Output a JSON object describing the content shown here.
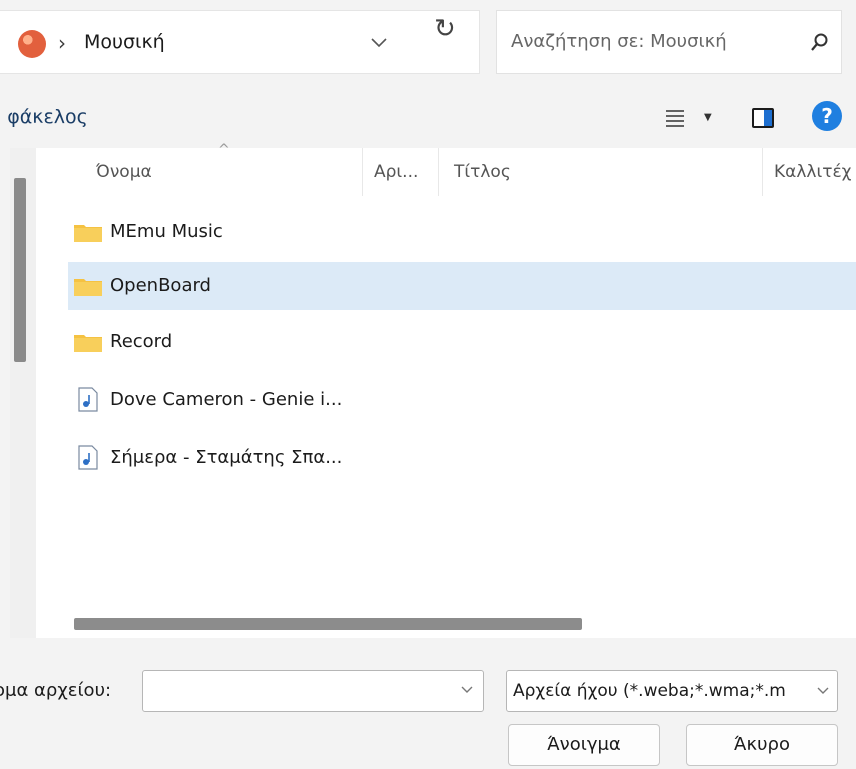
{
  "address": {
    "location": "Μουσική",
    "separator": "›"
  },
  "search": {
    "placeholder": "Αναζήτηση σε: Μουσική"
  },
  "toolbar": {
    "new_folder": "ς φάκελος",
    "help": "?",
    "refresh": "↻"
  },
  "columns": [
    "Όνομα",
    "Αρι...",
    "Τίτλος",
    "Καλλιτέχ"
  ],
  "files": [
    {
      "name": "MEmu Music",
      "type": "folder",
      "selected": false
    },
    {
      "name": "OpenBoard",
      "type": "folder",
      "selected": true
    },
    {
      "name": "Record",
      "type": "folder",
      "selected": false
    },
    {
      "name": "Dove Cameron - Genie i...",
      "type": "audio",
      "selected": false
    },
    {
      "name": "Σήμερα - Σταμάτης Σπα...",
      "type": "audio",
      "selected": false
    }
  ],
  "bottom": {
    "filename_label": "ομα αρχείου:",
    "filename_value": "",
    "filetype": "Αρχεία ήχου (*.weba;*.wma;*.m",
    "open_button": "Άνοιγμα",
    "cancel_button": "Άκυρο"
  },
  "colors": {
    "selection": "#dceaf7",
    "folder": "#f5c242",
    "accent": "#1f7fe0"
  }
}
